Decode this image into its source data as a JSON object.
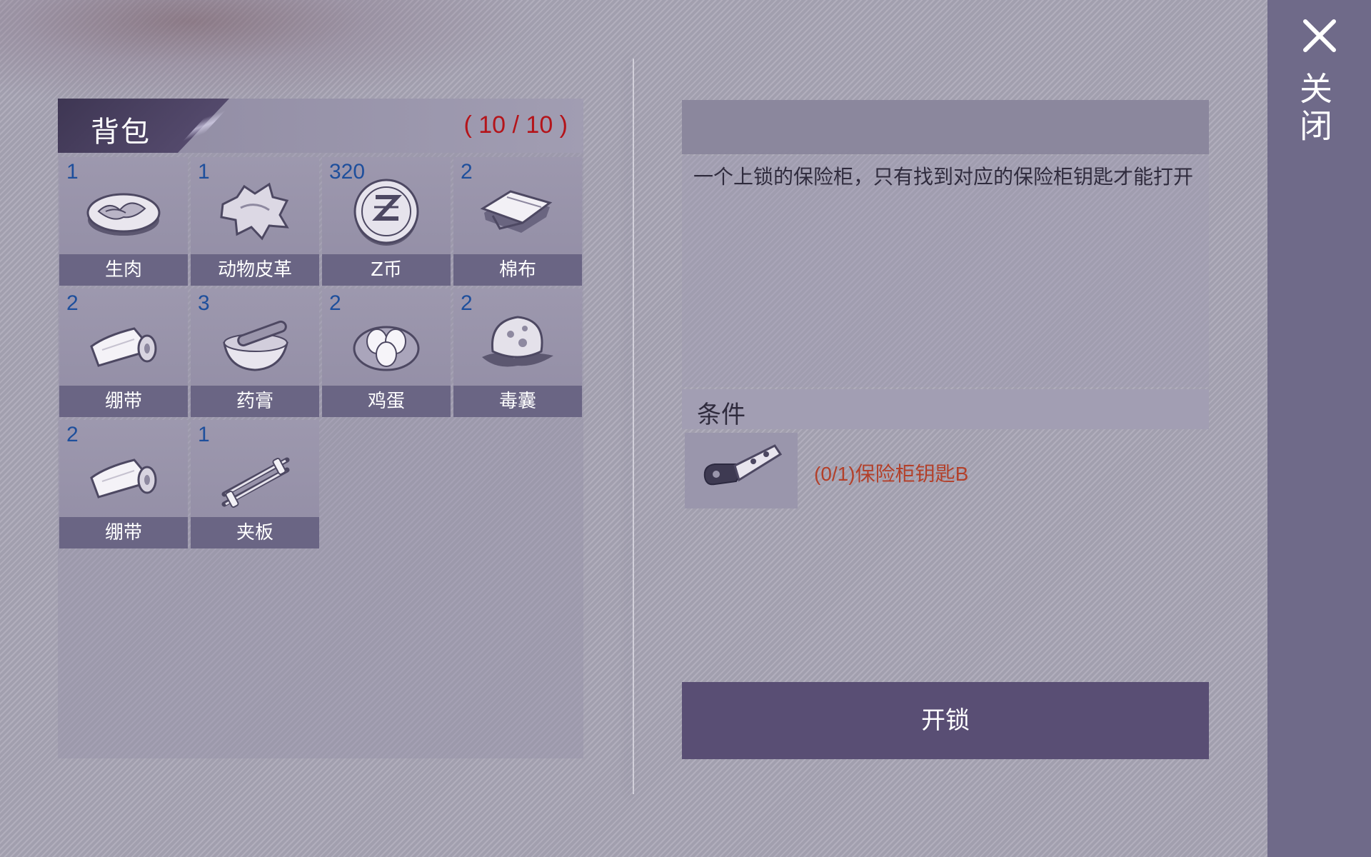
{
  "inventory": {
    "title": "背包",
    "count": "( 10 / 10 )",
    "items": [
      {
        "qty": "1",
        "name": "生肉",
        "icon": "raw-meat-icon"
      },
      {
        "qty": "1",
        "name": "动物皮革",
        "icon": "animal-hide-icon"
      },
      {
        "qty": "320",
        "name": "Z币",
        "icon": "z-coin-icon"
      },
      {
        "qty": "2",
        "name": "棉布",
        "icon": "cotton-cloth-icon"
      },
      {
        "qty": "2",
        "name": "绷带",
        "icon": "bandage-icon"
      },
      {
        "qty": "3",
        "name": "药膏",
        "icon": "ointment-icon"
      },
      {
        "qty": "2",
        "name": "鸡蛋",
        "icon": "eggs-icon"
      },
      {
        "qty": "2",
        "name": "毒囊",
        "icon": "poison-sac-icon"
      },
      {
        "qty": "2",
        "name": "绷带",
        "icon": "bandage-icon"
      },
      {
        "qty": "1",
        "name": "夹板",
        "icon": "splint-icon"
      }
    ]
  },
  "detail": {
    "title": "",
    "description": "一个上锁的保险柜，只有找到对应的保险柜钥匙才能打开",
    "conditions_label": "条件",
    "condition_item": {
      "text": "(0/1)保险柜钥匙B",
      "icon": "key-icon"
    },
    "unlock_label": "开锁"
  },
  "close": {
    "label": "关闭",
    "icon": "close-icon"
  },
  "colors": {
    "accent": "#594e74",
    "count_red": "#b4141a",
    "qty_blue": "#1e4f9c",
    "condition_text": "#b3402a"
  }
}
